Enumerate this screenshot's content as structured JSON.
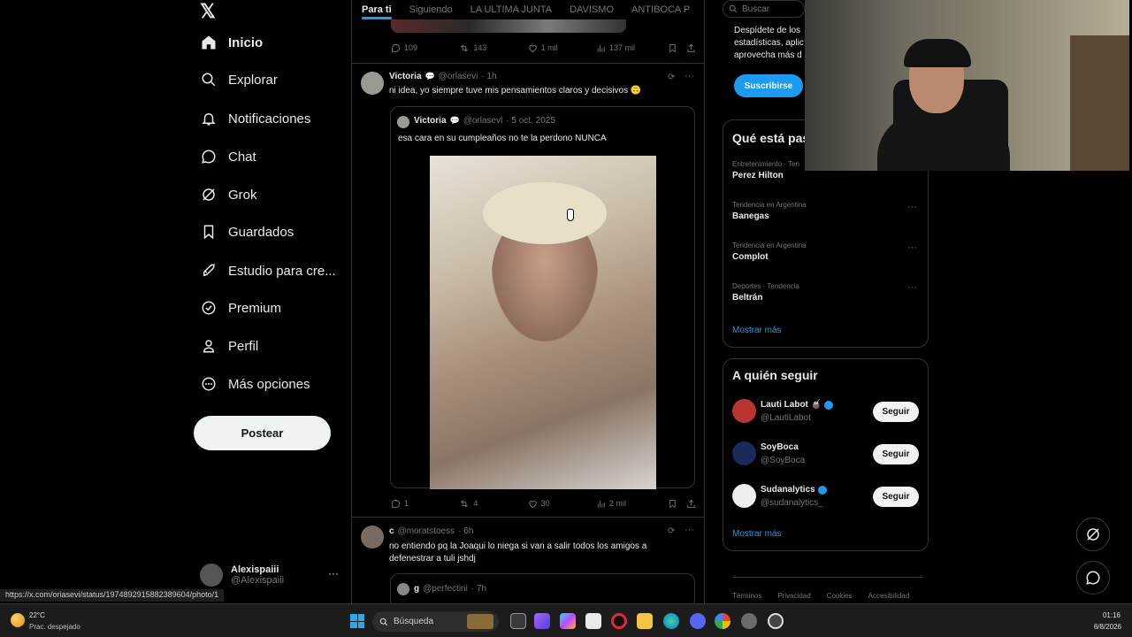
{
  "nav": {
    "logo": "𝕏",
    "items": [
      {
        "label": "Inicio",
        "icon": "home-icon"
      },
      {
        "label": "Explorar",
        "icon": "search-icon"
      },
      {
        "label": "Notificaciones",
        "icon": "bell-icon"
      },
      {
        "label": "Chat",
        "icon": "chat-icon"
      },
      {
        "label": "Grok",
        "icon": "grok-icon"
      },
      {
        "label": "Guardados",
        "icon": "bookmark-icon"
      },
      {
        "label": "Estudio para cre...",
        "icon": "rocket-icon"
      },
      {
        "label": "Premium",
        "icon": "verified-icon"
      },
      {
        "label": "Perfil",
        "icon": "person-icon"
      },
      {
        "label": "Más opciones",
        "icon": "more-circle-icon"
      }
    ],
    "post_button": "Postear",
    "account": {
      "name": "Alexispaiii",
      "handle": "@Alexispaiii",
      "more": "···"
    }
  },
  "timeline": {
    "tabs": [
      "Para ti",
      "Siguiendo",
      "LA ULTIMA JUNTA",
      "DAVISMO",
      "ANTIBOCA P",
      "+"
    ],
    "top_actions": {
      "replies": "109",
      "reposts": "143",
      "likes": "1 mil",
      "views": "137 mil"
    },
    "tweet1": {
      "name": "Victoria",
      "handle": "@orlasevi",
      "time": "· 1h",
      "text": "ni idea, yo siempre tuve mis pensamientos claros y decisivos 🙃",
      "quote": {
        "name": "Victoria",
        "handle": "@orlasevl",
        "time": "· 5 oct. 2025",
        "text": "esa cara en su cumpleaños no te la perdono NUNCA"
      },
      "actions": {
        "replies": "1",
        "reposts": "4",
        "likes": "30",
        "views": "2 mil"
      }
    },
    "tweet2": {
      "name": "c",
      "handle": "@moratstoess",
      "time": "· 6h",
      "text": "no entiendo pq la Joaqui lo niega si van a salir todos los amigos a defenestrar a tuli jshdj",
      "quote": {
        "name": "g",
        "handle": "@perfectini",
        "time": "· 7h"
      }
    }
  },
  "right": {
    "search_placeholder": "Buscar",
    "premium": {
      "text": "Despídete de los estadísticas, aplic aprovecha más d",
      "button": "Suscribirse"
    },
    "trends": {
      "title": "Qué está pas",
      "items": [
        {
          "category": "Entretenimiento · Ten",
          "name": "Perez Hilton"
        },
        {
          "category": "Tendencia en Argentina",
          "name": "Banegas"
        },
        {
          "category": "Tendencia en Argentina",
          "name": "Complot"
        },
        {
          "category": "Deportes · Tendencia",
          "name": "Beltrán"
        }
      ],
      "show_more": "Mostrar más"
    },
    "who_to_follow": {
      "title": "A quién seguir",
      "items": [
        {
          "name": "Lauti Labot 🧉",
          "handle": "@LautiLabot",
          "button": "Seguir"
        },
        {
          "name": "SoyBoca",
          "handle": "@SoyBoca",
          "button": "Seguir"
        },
        {
          "name": "Sudanalytics",
          "handle": "@sudanalytics_",
          "button": "Seguir"
        }
      ],
      "show_more": "Mostrar más"
    },
    "footer": [
      "Términos",
      "Privacidad",
      "Cookies",
      "Accesibilidad"
    ]
  },
  "status_url": "https://x.com/oriasevi/status/1974892915882389604/photo/1",
  "taskbar": {
    "weather_temp": "22°C",
    "weather_desc": "Prac. despejado",
    "search": "Búsqueda",
    "time": "01:16",
    "date": "6/8/2026"
  },
  "colors": {
    "accent": "#1d9bf0",
    "background": "#000000",
    "border": "#2f3336"
  }
}
